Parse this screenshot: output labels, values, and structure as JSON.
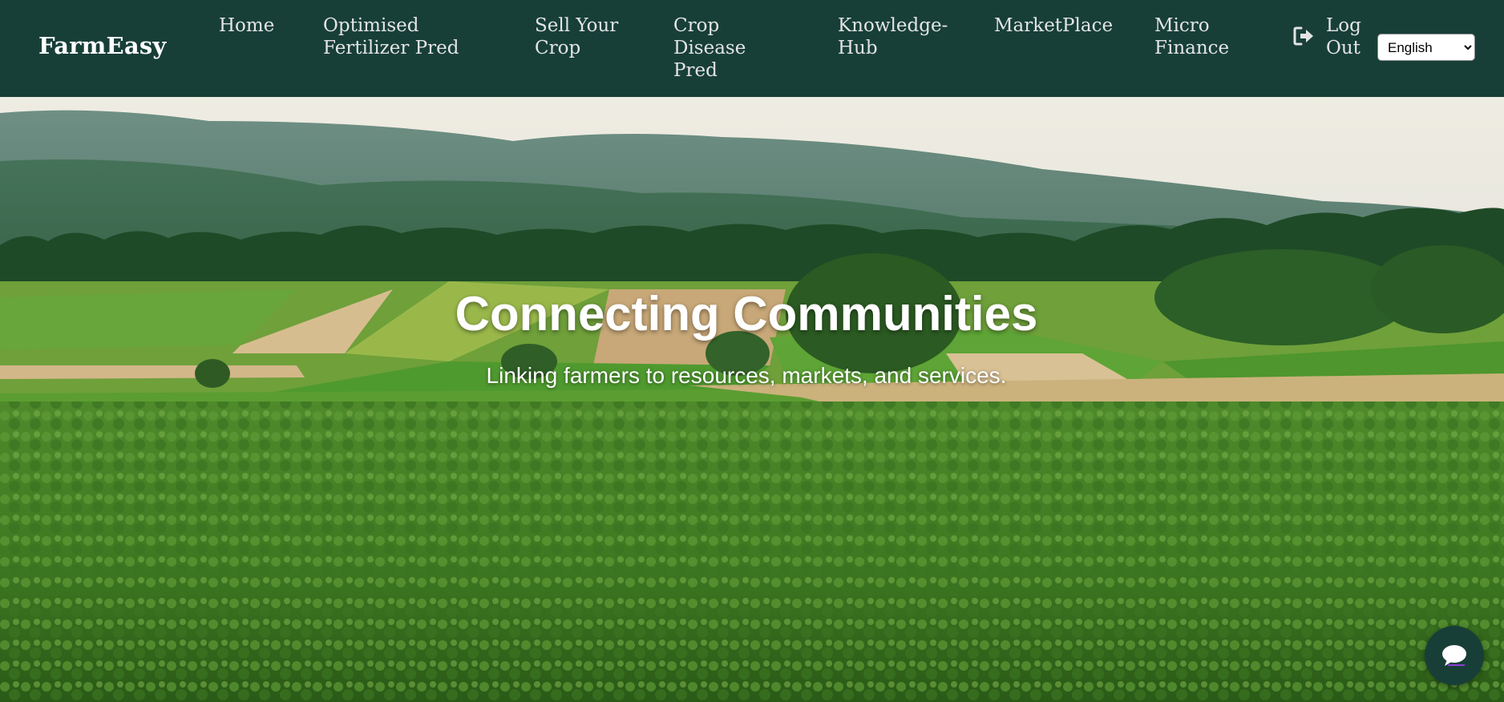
{
  "navbar": {
    "brand": "FarmEasy",
    "links": [
      {
        "label": "Home"
      },
      {
        "label": "Optimised Fertilizer Pred"
      },
      {
        "label": "Sell Your Crop"
      },
      {
        "label": "Crop Disease Pred"
      },
      {
        "label": "Knowledge-Hub"
      },
      {
        "label": "MarketPlace"
      },
      {
        "label": "Micro Finance"
      }
    ],
    "logout": {
      "label": "Log Out",
      "icon": "sign-out-icon"
    },
    "language": {
      "selected": "English",
      "options": [
        "English"
      ]
    }
  },
  "hero": {
    "title": "Connecting Communities",
    "subtitle": "Linking farmers to resources, markets, and services."
  },
  "chat": {
    "icon": "chat-bubble-icon"
  },
  "colors": {
    "navbar_bg": "#173f38",
    "nav_text": "#e4e4e4",
    "brand_text": "#ffffff",
    "hero_text": "#ffffff"
  }
}
